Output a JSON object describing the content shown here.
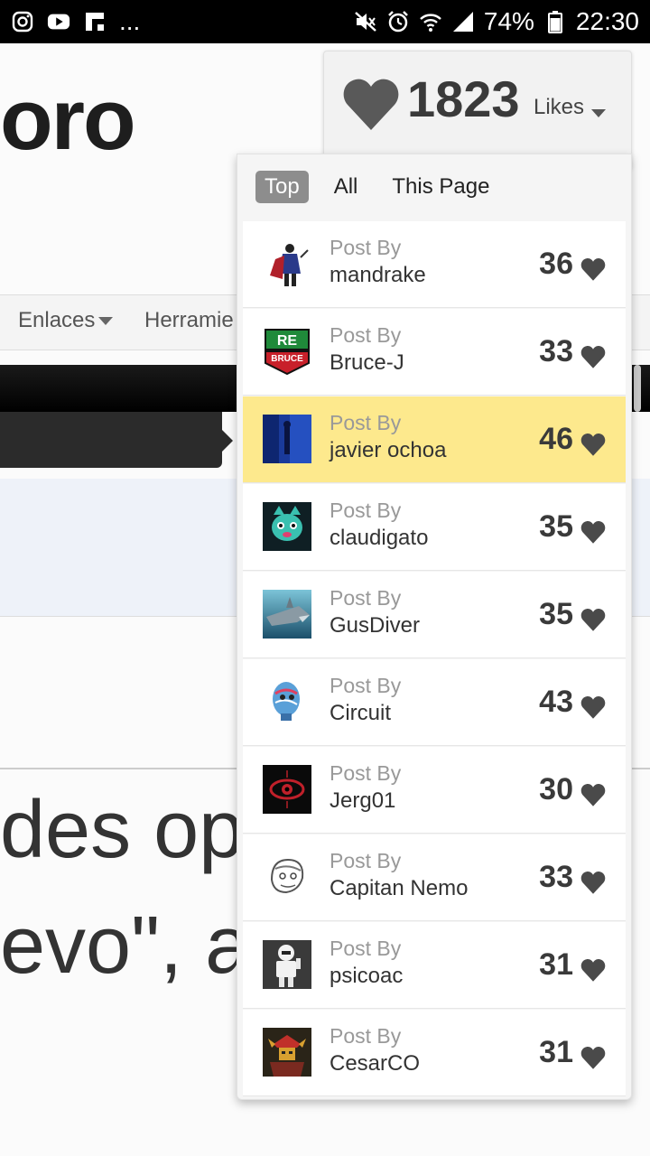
{
  "status_bar": {
    "battery": "74%",
    "time": "22:30",
    "more": "..."
  },
  "background": {
    "title_fragment": "oro",
    "nav": [
      {
        "label": "Enlaces"
      },
      {
        "label": "Herramie"
      }
    ],
    "body_text_lines": [
      "des op",
      "evo\", a"
    ]
  },
  "likes_widget": {
    "count": "1823",
    "label": "Likes",
    "heart_color": "#595959"
  },
  "tabs": [
    {
      "label": "Top",
      "active": true
    },
    {
      "label": "All",
      "active": false
    },
    {
      "label": "This Page",
      "active": false
    }
  ],
  "posts": [
    {
      "post_by": "Post By",
      "user": "mandrake",
      "likes": "36",
      "highlighted": false
    },
    {
      "post_by": "Post By",
      "user": "Bruce-J",
      "likes": "33",
      "highlighted": false
    },
    {
      "post_by": "Post By",
      "user": "javier ochoa",
      "likes": "46",
      "highlighted": true
    },
    {
      "post_by": "Post By",
      "user": "claudigato",
      "likes": "35",
      "highlighted": false
    },
    {
      "post_by": "Post By",
      "user": "GusDiver",
      "likes": "35",
      "highlighted": false
    },
    {
      "post_by": "Post By",
      "user": "Circuit",
      "likes": "43",
      "highlighted": false
    },
    {
      "post_by": "Post By",
      "user": "Jerg01",
      "likes": "30",
      "highlighted": false
    },
    {
      "post_by": "Post By",
      "user": "Capitan Nemo",
      "likes": "33",
      "highlighted": false
    },
    {
      "post_by": "Post By",
      "user": "psicoac",
      "likes": "31",
      "highlighted": false
    },
    {
      "post_by": "Post By",
      "user": "CesarCO",
      "likes": "31",
      "highlighted": false
    }
  ],
  "avatar_badges": {
    "bruce_top": "RE",
    "bruce_bottom": "BRUCE"
  },
  "colors": {
    "highlight": "#fde98d",
    "active_tab": "#8d8d8d"
  }
}
